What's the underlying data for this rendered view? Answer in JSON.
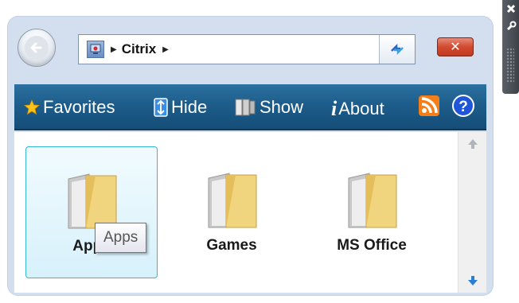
{
  "address": {
    "crumbs": [
      "Citrix"
    ]
  },
  "toolbar": {
    "favorites_label": "Favorites",
    "hide_label": "Hide",
    "show_label": "Show",
    "about_label": "About"
  },
  "folders": [
    {
      "label": "Apps",
      "selected": true
    },
    {
      "label": "Games",
      "selected": false
    },
    {
      "label": "MS Office",
      "selected": false
    }
  ],
  "tooltip": {
    "text": "Apps"
  },
  "colors": {
    "gadget_bg": "#d3dfee",
    "toolbar_bg": "#1d5d8b",
    "close_red": "#d24a30",
    "selection_border": "#35b8d8",
    "folder_yellow": "#f1d47e",
    "rss_orange": "#f57e19",
    "help_blue": "#1f55d8"
  },
  "icons": [
    "back-arrow-icon",
    "computer-icon",
    "refresh-icon",
    "close-icon",
    "star-icon",
    "hide-icon",
    "show-icon",
    "info-icon",
    "rss-icon",
    "help-icon",
    "folder-icon",
    "scroll-up-icon",
    "scroll-down-icon",
    "wrench-icon"
  ]
}
